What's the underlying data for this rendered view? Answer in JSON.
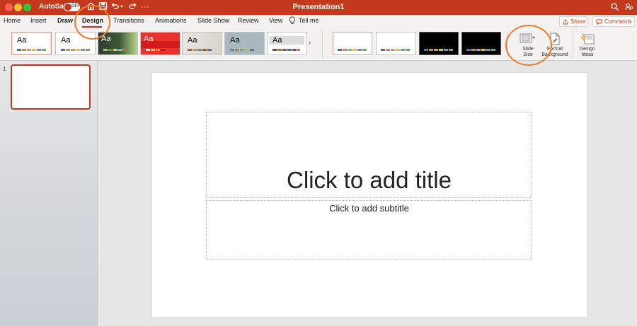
{
  "titlebar": {
    "autosave_label": "AutoSave",
    "autosave_state": "OFF",
    "window_title": "Presentation1",
    "more_symbol": "···"
  },
  "tabs": [
    {
      "label": "Home"
    },
    {
      "label": "Insert"
    },
    {
      "label": "Draw"
    },
    {
      "label": "Design"
    },
    {
      "label": "Transitions"
    },
    {
      "label": "Animations"
    },
    {
      "label": "Slide Show"
    },
    {
      "label": "Review"
    },
    {
      "label": "View"
    },
    {
      "label": "Tell me"
    }
  ],
  "actions": {
    "share_label": "Share",
    "comments_label": "Comments"
  },
  "ribbon": {
    "theme_sample": "Aa",
    "gallery_arrow": "›",
    "slide_size_line1": "Slide",
    "slide_size_line2": "Size",
    "format_bg_line1": "Format",
    "format_bg_line2": "Background",
    "design_ideas_line1": "Design",
    "design_ideas_line2": "Ideas"
  },
  "slides_panel": {
    "slide_number": "1"
  },
  "slide": {
    "title_placeholder": "Click to add title",
    "subtitle_placeholder": "Click to add subtitle"
  },
  "colors": {
    "accent": "#c4391b",
    "annotation": "#f47a2b"
  }
}
